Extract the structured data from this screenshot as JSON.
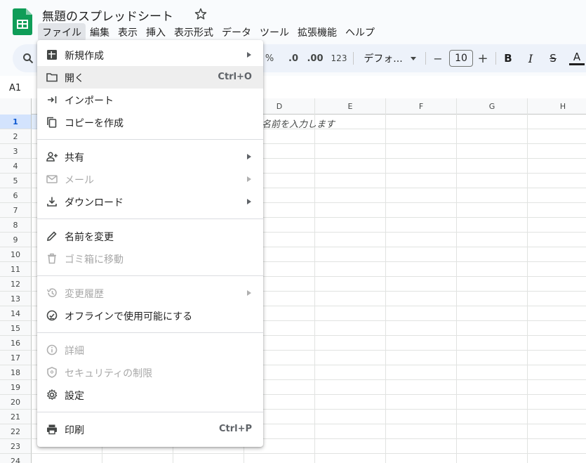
{
  "header": {
    "title": "無題のスプレッドシート",
    "brand_color": "#0f9d58"
  },
  "menubar": {
    "items": [
      "ファイル",
      "編集",
      "表示",
      "挿入",
      "表示形式",
      "データ",
      "ツール",
      "拡張機能",
      "ヘルプ"
    ],
    "active_index": 0
  },
  "toolbar": {
    "percent": "%",
    "dec_decrease": ".0",
    "dec_increase": ".00",
    "number_format": "123",
    "font_family": "デフォ...",
    "font_size": "10",
    "minus": "−",
    "plus": "+",
    "bold": "B",
    "italic": "I",
    "strike": "S",
    "text_color": "A"
  },
  "formula_bar": {
    "name_box": "A1"
  },
  "grid": {
    "columns": [
      "D",
      "E",
      "F",
      "G",
      "H"
    ],
    "rows": [
      "1",
      "2",
      "3",
      "4",
      "5",
      "6",
      "7",
      "8",
      "9",
      "10",
      "11",
      "12",
      "13",
      "14",
      "15",
      "16",
      "17",
      "18",
      "19",
      "20",
      "21",
      "22",
      "23",
      "24"
    ],
    "selected_row": "1",
    "cell_hint": "に名前を入力します"
  },
  "file_menu": {
    "items": [
      {
        "label": "新規作成",
        "icon": "new-sheet-icon",
        "submenu": true
      },
      {
        "label": "開く",
        "icon": "folder-icon",
        "shortcut": "Ctrl+O",
        "hover": true
      },
      {
        "label": "インポート",
        "icon": "import-icon"
      },
      {
        "label": "コピーを作成",
        "icon": "copy-icon"
      },
      {
        "label": "共有",
        "icon": "person-add-icon",
        "submenu": true
      },
      {
        "label": "メール",
        "icon": "mail-icon",
        "submenu": true,
        "disabled": true
      },
      {
        "label": "ダウンロード",
        "icon": "download-icon",
        "submenu": true
      },
      {
        "label": "名前を変更",
        "icon": "pencil-icon"
      },
      {
        "label": "ゴミ箱に移動",
        "icon": "trash-icon",
        "disabled": true
      },
      {
        "label": "変更履歴",
        "icon": "history-icon",
        "submenu": true,
        "disabled": true
      },
      {
        "label": "オフラインで使用可能にする",
        "icon": "offline-check-icon"
      },
      {
        "label": "詳細",
        "icon": "info-icon",
        "disabled": true
      },
      {
        "label": "セキュリティの制限",
        "icon": "security-shield-icon",
        "disabled": true
      },
      {
        "label": "設定",
        "icon": "gear-icon"
      },
      {
        "label": "印刷",
        "icon": "printer-icon",
        "shortcut": "Ctrl+P"
      }
    ]
  }
}
